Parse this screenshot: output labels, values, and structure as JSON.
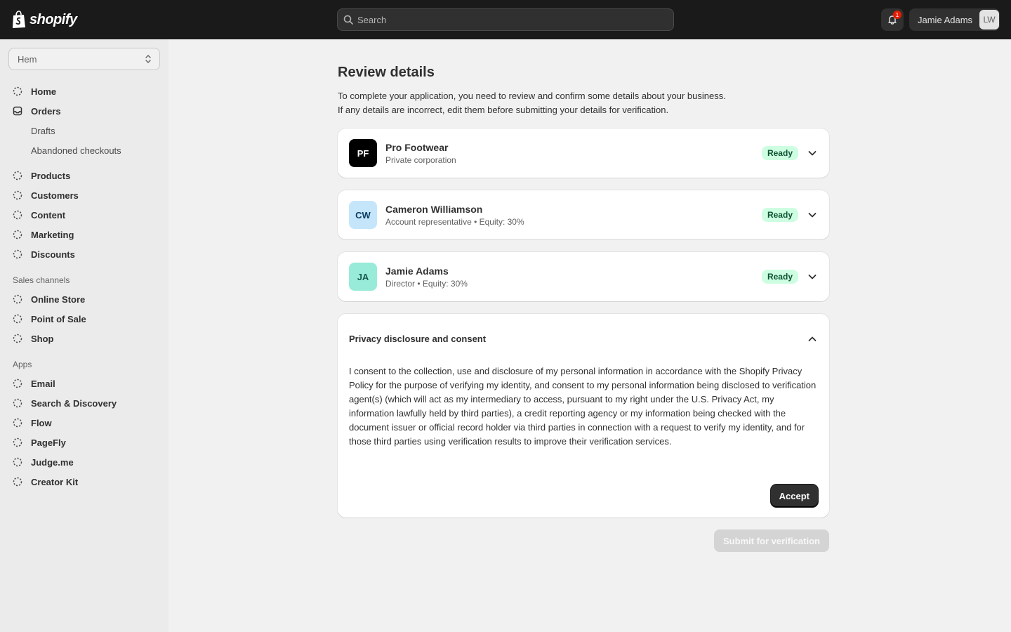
{
  "topbar": {
    "logo_text": "shopify",
    "search_placeholder": "Search",
    "notification_count": "1",
    "user_name": "Jamie Adams",
    "user_initials": "LW"
  },
  "sidebar": {
    "store": "Hem",
    "items": [
      {
        "label": "Home"
      },
      {
        "label": "Orders"
      }
    ],
    "order_subitems": [
      {
        "label": "Drafts"
      },
      {
        "label": "Abandoned checkouts"
      }
    ],
    "items2": [
      {
        "label": "Products"
      },
      {
        "label": "Customers"
      },
      {
        "label": "Content"
      },
      {
        "label": "Marketing"
      },
      {
        "label": "Discounts"
      }
    ],
    "sales_channels_heading": "Sales channels",
    "sales_channels": [
      {
        "label": "Online Store"
      },
      {
        "label": "Point of Sale"
      },
      {
        "label": "Shop"
      }
    ],
    "apps_heading": "Apps",
    "apps": [
      {
        "label": "Email"
      },
      {
        "label": "Search & Discovery"
      },
      {
        "label": "Flow"
      },
      {
        "label": "PageFly"
      },
      {
        "label": "Judge.me"
      },
      {
        "label": "Creator Kit"
      }
    ]
  },
  "main": {
    "title": "Review details",
    "intro_line1": "To complete your application, you need to review and confirm some details about your business.",
    "intro_line2": "If any details are incorrect, edit them before submitting your details for verification.",
    "rows": [
      {
        "initials": "PF",
        "name": "Pro Footwear",
        "sub": "Private corporation",
        "status": "Ready",
        "avatar_bg": "#000000",
        "avatar_fg": "#ffffff"
      },
      {
        "initials": "CW",
        "name": "Cameron Williamson",
        "sub": "Account representative • Equity: 30%",
        "status": "Ready",
        "avatar_bg": "#c5e5fb",
        "avatar_fg": "#0b3d63"
      },
      {
        "initials": "JA",
        "name": "Jamie Adams",
        "sub": "Director • Equity: 30%",
        "status": "Ready",
        "avatar_bg": "#97ebd8",
        "avatar_fg": "#1a5b4c"
      }
    ],
    "privacy": {
      "title": "Privacy disclosure and consent",
      "body": "I consent to the collection, use and disclosure of my personal information in accordance with the Shopify Privacy Policy for the purpose of verifying my identity, and consent to my personal information being disclosed to verification agent(s) (which will act as my intermediary to access, pursuant to my right under the U.S. Privacy Act, my information lawfully held by third parties), a credit reporting agency or my information being checked with the document issuer or official record holder via third parties in connection with a request to verify my identity, and for those third parties using verification results to improve their verification services.",
      "accept_label": "Accept"
    },
    "submit_label": "Submit for verification"
  }
}
